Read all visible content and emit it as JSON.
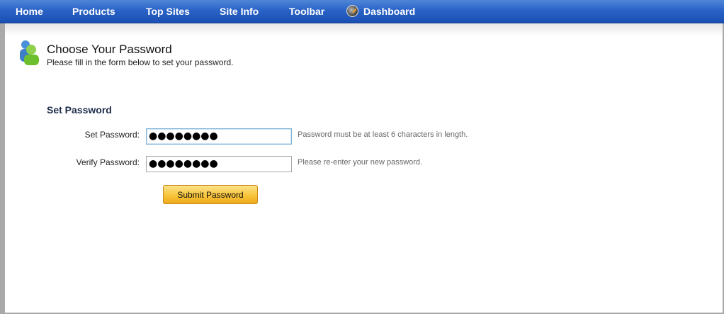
{
  "nav": {
    "items": [
      {
        "label": "Home"
      },
      {
        "label": "Products"
      },
      {
        "label": "Top Sites"
      },
      {
        "label": "Site Info"
      },
      {
        "label": "Toolbar"
      },
      {
        "label": "Dashboard",
        "icon": "dashboard-gauge-icon"
      }
    ]
  },
  "header": {
    "title": "Choose Your Password",
    "subtitle": "Please fill in the form below to set your password.",
    "icon": "users-icon"
  },
  "form": {
    "section_title": "Set Password",
    "set_password": {
      "label": "Set Password:",
      "value": "●●●●●●●●",
      "hint": "Password must be at least 6 characters in length."
    },
    "verify_password": {
      "label": "Verify Password:",
      "value": "●●●●●●●●",
      "hint": "Please re-enter your new password."
    },
    "submit_label": "Submit Password"
  },
  "colors": {
    "nav_blue": "#2a63c7",
    "button_gold": "#f7c43a",
    "section_title": "#1d2c4a"
  }
}
